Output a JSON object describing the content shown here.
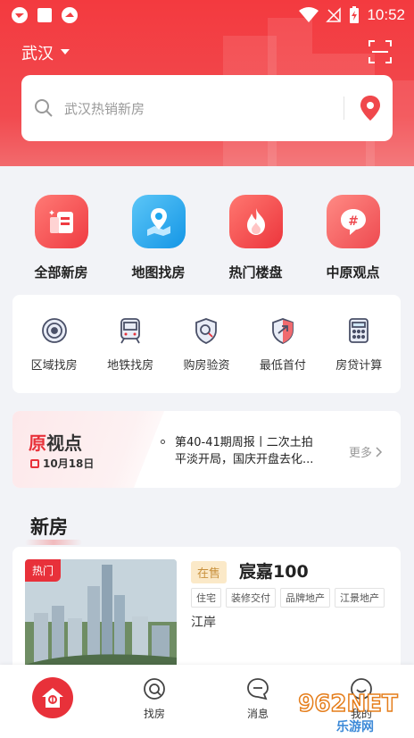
{
  "status_bar": {
    "time": "10:52"
  },
  "header": {
    "city": "武汉",
    "search_placeholder": "武汉热销新房"
  },
  "main_nav": [
    {
      "label": "全部新房",
      "icon": "all-houses-icon",
      "color": "#f0484c"
    },
    {
      "label": "地图找房",
      "icon": "map-pin-icon",
      "color": "#1ea7ef"
    },
    {
      "label": "热门楼盘",
      "icon": "flame-icon",
      "color": "#f0484c"
    },
    {
      "label": "中原观点",
      "icon": "hashtag-icon",
      "color": "#f0575a"
    }
  ],
  "tools": [
    {
      "label": "区域找房",
      "icon": "region-icon"
    },
    {
      "label": "地铁找房",
      "icon": "metro-icon"
    },
    {
      "label": "购房验资",
      "icon": "verify-shield-icon"
    },
    {
      "label": "最低首付",
      "icon": "down-payment-icon"
    },
    {
      "label": "房贷计算",
      "icon": "calculator-icon"
    }
  ],
  "viewpoint": {
    "title_first": "原",
    "title_rest": "视点",
    "date": "10月18日",
    "headline_line1": "第40-41期周报丨二次土拍",
    "headline_line2": "平淡开局，国庆开盘去化...",
    "more_label": "更多"
  },
  "section": {
    "title": "新房"
  },
  "listing": {
    "hot_badge": "热门",
    "status": "在售",
    "name": "宸嘉100",
    "tags": [
      "住宅",
      "装修交付",
      "品牌地产",
      "江景地产"
    ],
    "district": "江岸"
  },
  "tabbar": {
    "tabs": [
      {
        "label": "",
        "icon": "home-icon"
      },
      {
        "label": "找房",
        "icon": "find-house-icon"
      },
      {
        "label": "消息",
        "icon": "message-icon"
      },
      {
        "label": "我的",
        "icon": "profile-icon"
      }
    ]
  },
  "watermark": {
    "text": "962NET",
    "sub": "乐游网"
  },
  "colors": {
    "brand_red": "#e8313a",
    "accent_blue": "#1ea7ef",
    "status_gold": "#c8903b"
  }
}
